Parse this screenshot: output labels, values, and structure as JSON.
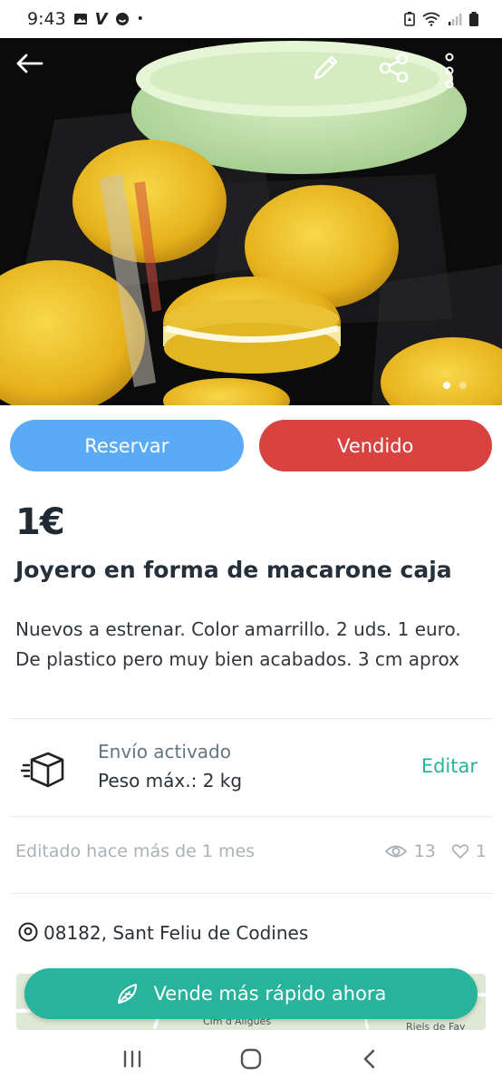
{
  "status_bar": {
    "time": "9:43"
  },
  "hero": {
    "image_count": 2,
    "active_index": 0
  },
  "actions": {
    "reserve_label": "Reservar",
    "sold_label": "Vendido"
  },
  "product": {
    "price": "1€",
    "title": "Joyero en forma de macarone caja",
    "description": "Nuevos a estrenar. Color amarrillo. 2 uds. 1 euro. De plastico pero muy bien acabados. 3 cm aprox"
  },
  "shipping": {
    "status": "Envío activado",
    "max_weight": "Peso máx.: 2 kg",
    "edit_label": "Editar"
  },
  "meta": {
    "edited": "Editado hace más de 1 mes",
    "views": "13",
    "likes": "1"
  },
  "location": {
    "text": "08182, Sant Feliu de Codines"
  },
  "map": {
    "label_1": "Cim d'Àligues",
    "label_2": "Riels de Fay"
  },
  "cta": {
    "label": "Vende más rápido ahora"
  },
  "colors": {
    "reserve": "#5aaaf6",
    "sold": "#d8423f",
    "accent": "#27b39c"
  }
}
